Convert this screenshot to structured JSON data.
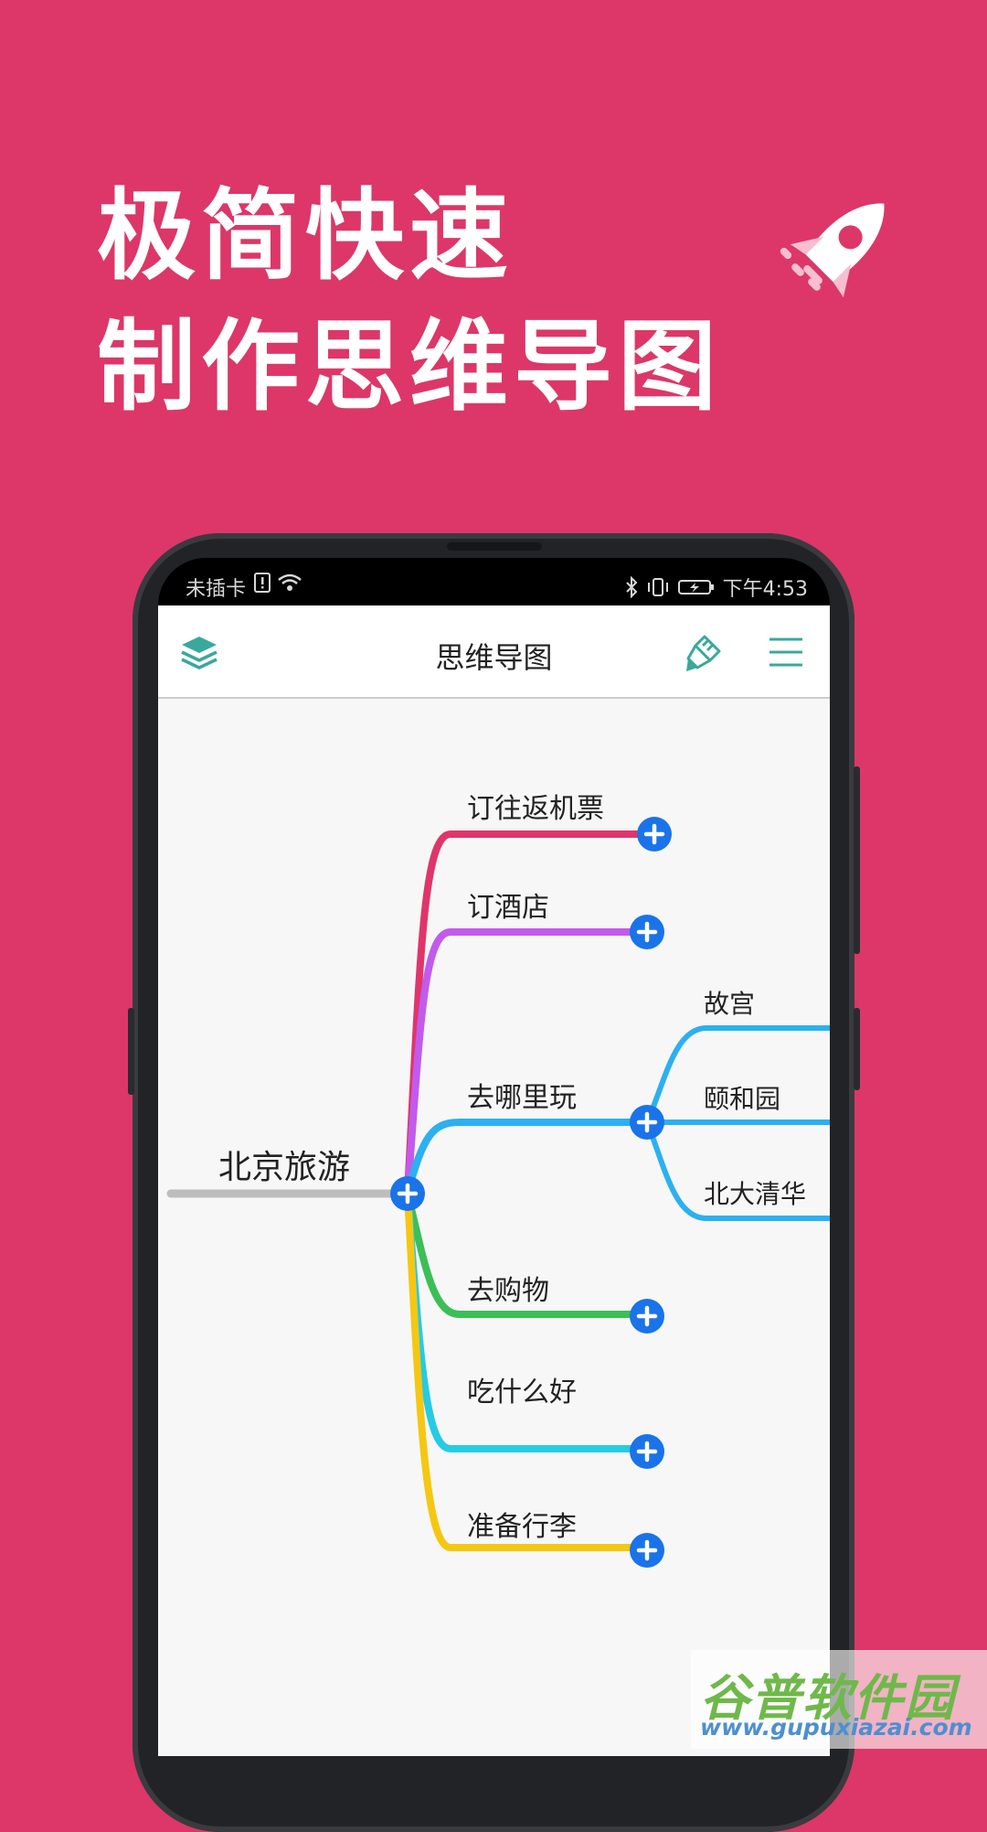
{
  "headline": {
    "line1": "极简快速",
    "line2": "制作思维导图"
  },
  "status_bar": {
    "carrier": "未插卡",
    "time": "下午4:53"
  },
  "app_bar": {
    "title": "思维导图"
  },
  "mindmap": {
    "root": "北京旅游",
    "branches": [
      {
        "label": "订往返机票",
        "color": "#e0356c"
      },
      {
        "label": "订酒店",
        "color": "#c25bec"
      },
      {
        "label": "去哪里玩",
        "color": "#2cb0f0",
        "children": [
          "故宫",
          "颐和园",
          "北大清华"
        ]
      },
      {
        "label": "去购物",
        "color": "#3bbf57"
      },
      {
        "label": "吃什么好",
        "color": "#25cbe4"
      },
      {
        "label": "准备行李",
        "color": "#f5c712"
      }
    ],
    "plus_color": "#1a73e8"
  },
  "watermark": {
    "brand": "谷普软件园",
    "url": "www.gupuxiazai.com"
  }
}
